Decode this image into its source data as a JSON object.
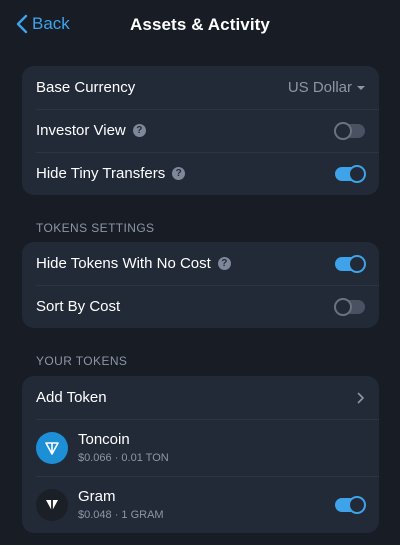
{
  "header": {
    "back_label": "Back",
    "title": "Assets & Activity"
  },
  "settings": {
    "base_currency_label": "Base Currency",
    "base_currency_value": "US Dollar",
    "investor_view_label": "Investor View",
    "investor_view_on": false,
    "hide_tiny_label": "Hide Tiny Transfers",
    "hide_tiny_on": true
  },
  "tokens_settings": {
    "section_title": "TOKENS SETTINGS",
    "hide_no_cost_label": "Hide Tokens With No Cost",
    "hide_no_cost_on": true,
    "sort_by_cost_label": "Sort By Cost",
    "sort_by_cost_on": false
  },
  "your_tokens": {
    "section_title": "YOUR TOKENS",
    "add_token_label": "Add Token",
    "items": [
      {
        "name": "Toncoin",
        "sub": "$0.066 · 0.01 TON",
        "icon": "toncoin-icon",
        "icon_bg": "#1d8fd6"
      },
      {
        "name": "Gram",
        "sub": "$0.048 · 1 GRAM",
        "icon": "gram-icon",
        "icon_bg": "#1b1f26",
        "toggle_on": true
      }
    ]
  },
  "help_glyph": "?",
  "colors": {
    "accent": "#3fa3ea",
    "background": "#171c25",
    "card": "#222a38"
  }
}
